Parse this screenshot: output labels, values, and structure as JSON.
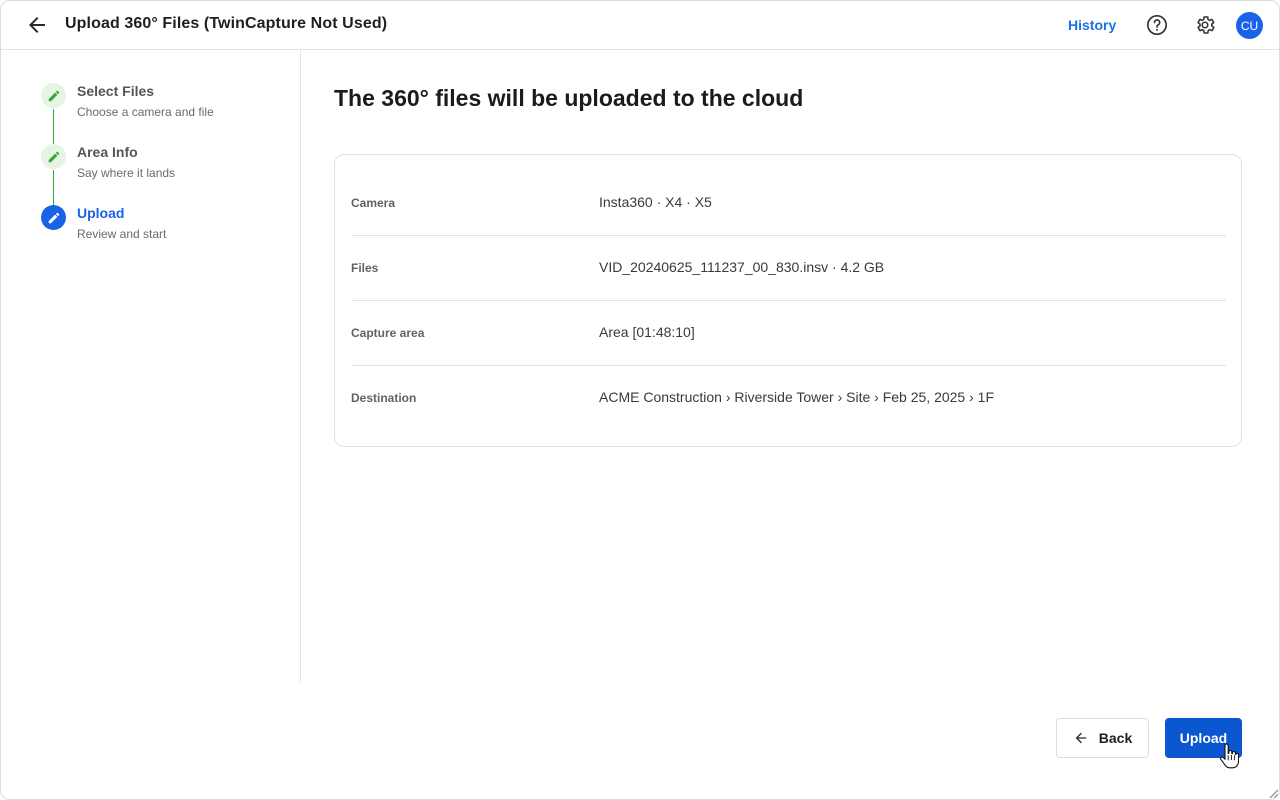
{
  "header": {
    "title": "Upload 360° Files (TwinCapture Not Used)",
    "history_label": "History",
    "avatar_initials": "CU",
    "icons": [
      "back-arrow-icon",
      "help-icon",
      "gear-icon"
    ]
  },
  "stepper": {
    "steps": [
      {
        "title": "Select Files",
        "subtitle": "Choose a camera and file",
        "state": "done"
      },
      {
        "title": "Area Info",
        "subtitle": "Say where it lands",
        "state": "done"
      },
      {
        "title": "Upload",
        "subtitle": "Review and start",
        "state": "active"
      }
    ]
  },
  "main": {
    "heading": "The 360° files will be uploaded to the cloud",
    "summary": [
      {
        "label": "Camera",
        "value": "Insta360 · X4 · X5"
      },
      {
        "label": "Files",
        "value": "VID_20240625_111237_00_830.insv · 4.2 GB"
      },
      {
        "label": "Capture area",
        "value": "Area [01:48:10]"
      },
      {
        "label": "Destination",
        "value": "ACME Construction › Riverside Tower › Site › Feb 25, 2025 › 1F"
      }
    ]
  },
  "footer": {
    "back_label": "Back",
    "upload_label": "Upload"
  },
  "colors": {
    "accent": "#1a62e8",
    "primary_button": "#0b57d0",
    "step_done_bg": "#e6f4e3",
    "step_done_icon": "#35a63a",
    "link": "#1a73e8"
  }
}
